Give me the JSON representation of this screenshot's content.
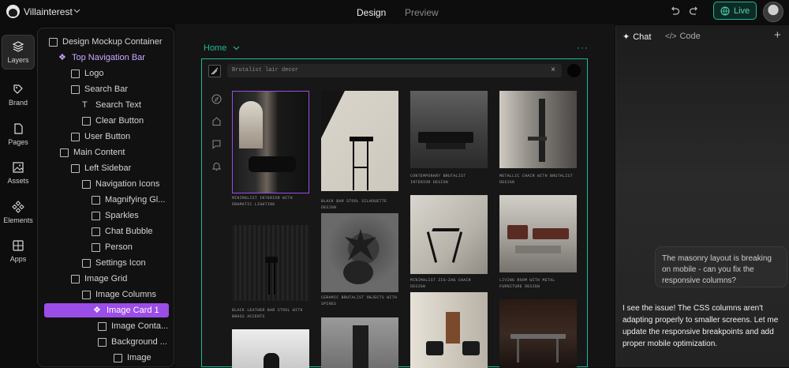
{
  "app": {
    "project_name": "Villainterest"
  },
  "topbar": {
    "tabs": [
      "Design",
      "Preview"
    ],
    "live_label": "Live"
  },
  "rail": {
    "items": [
      "Layers",
      "Brand",
      "Pages",
      "Assets",
      "Elements",
      "Apps"
    ]
  },
  "layers": [
    {
      "label": "Design Mockup Container",
      "icon": "box-icon"
    },
    {
      "label": "Top Navigation Bar",
      "icon": "component-icon"
    },
    {
      "label": "Logo",
      "icon": "box-icon"
    },
    {
      "label": "Search Bar",
      "icon": "box-icon"
    },
    {
      "label": "Search Text",
      "icon": "text-icon"
    },
    {
      "label": "Clear Button",
      "icon": "box-icon"
    },
    {
      "label": "User Button",
      "icon": "box-icon"
    },
    {
      "label": "Main Content",
      "icon": "box-icon"
    },
    {
      "label": "Left Sidebar",
      "icon": "box-icon"
    },
    {
      "label": "Navigation Icons",
      "icon": "box-icon"
    },
    {
      "label": "Magnifying Gl...",
      "icon": "image-icon"
    },
    {
      "label": "Sparkles",
      "icon": "image-icon"
    },
    {
      "label": "Chat Bubble",
      "icon": "image-icon"
    },
    {
      "label": "Person",
      "icon": "image-icon"
    },
    {
      "label": "Settings Icon",
      "icon": "box-icon"
    },
    {
      "label": "Image Grid",
      "icon": "box-icon"
    },
    {
      "label": "Image Columns",
      "icon": "box-icon"
    },
    {
      "label": "Image Card 1",
      "icon": "component-icon"
    },
    {
      "label": "Image Conta...",
      "icon": "box-icon"
    },
    {
      "label": "Background ...",
      "icon": "box-icon"
    },
    {
      "label": "Image",
      "icon": "image-icon"
    }
  ],
  "canvas": {
    "page_label": "Home",
    "search_placeholder": "Brutalist lair decor"
  },
  "captions": {
    "c1": "MINIMALIST INTERIOR WITH DRAMATIC LIGHTING",
    "c2": "BLACK BAR STOOL SILHOUETTE DESIGN",
    "c3": "CONTEMPORARY BRUTALIST INTERIOR DESIGN",
    "c4": "METALLIC CHAIR WITH BRUTALIST DESIGN",
    "c5": "BLACK LEATHER BAR STOOL WITH BRASS ACCENTS",
    "c6": "CERAMIC BRUTALIST OBJECTS WITH SPIKES",
    "c7": "MINIMALIST ZIG-ZAG CHAIR DESIGN",
    "c8": "LIVING ROOM WITH METAL FURNITURE DESIGN"
  },
  "chat": {
    "tabs": [
      "Chat",
      "Code"
    ],
    "user_message": "The masonry layout is breaking on mobile - can you fix the responsive columns?",
    "assistant_message": "I see the issue! The CSS columns aren't adapting properly to smaller screens. Let me update the responsive breakpoints and add proper mobile optimization."
  },
  "colors": {
    "accent": "#1fb89a",
    "selection": "#9b4de8",
    "component": "#c9a8ff"
  }
}
